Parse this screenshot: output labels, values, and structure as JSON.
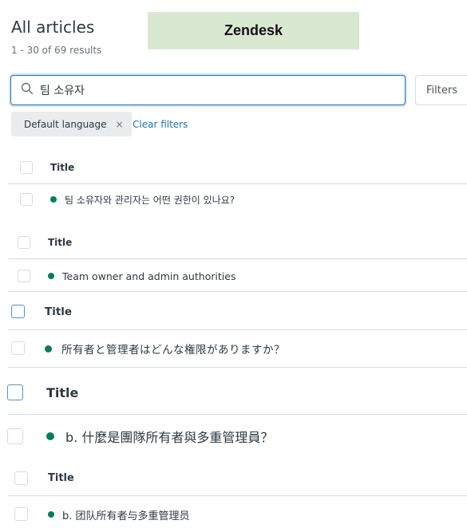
{
  "header": {
    "title": "All articles",
    "result_count": "1 - 30 of 69 results",
    "banner": "Zendesk"
  },
  "search": {
    "value": "팀 소유자",
    "icon": "search-icon"
  },
  "filters_button": "Filters",
  "active_filter": {
    "label": "Default language",
    "remove_symbol": "×"
  },
  "clear_filters": "Clear filters",
  "colors": {
    "status_dot": "#038153",
    "accent": "#1f73b7",
    "banner_bg": "#d9e8d1"
  },
  "sections": [
    {
      "column_header": "Title",
      "article": "팀 소유자와 관리자는 어떤 권한이 있나요?"
    },
    {
      "column_header": "Title",
      "article": "Team owner and admin authorities"
    },
    {
      "column_header": "Title",
      "article": "所有者と管理者はどんな権限がありますか？"
    },
    {
      "column_header": "Title",
      "article": "b. 什麼是團隊所有者與多重管理員？"
    },
    {
      "column_header": "Title",
      "article": "b. 团队所有者与多重管理员"
    }
  ]
}
